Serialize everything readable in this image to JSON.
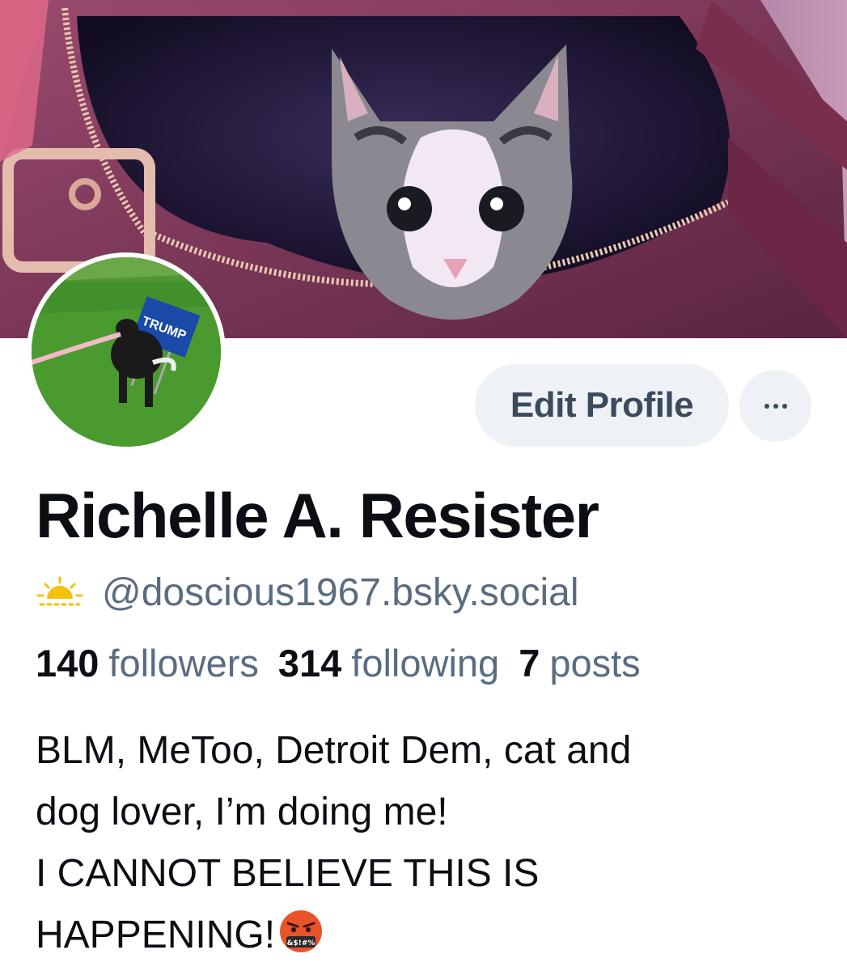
{
  "profile": {
    "display_name": "Richelle A. Resister",
    "handle": "@doscious1967.bsky.social",
    "handle_icon": "sun-icon",
    "edit_button_label": "Edit Profile",
    "more_button_icon": "ellipsis-icon",
    "stats": [
      {
        "count": "140",
        "label": "followers"
      },
      {
        "count": "314",
        "label": "following"
      },
      {
        "count": "7",
        "label": "posts"
      }
    ],
    "bio_lines": [
      "BLM, MeToo, Detroit Dem, cat and",
      "dog lover, I’m doing me!",
      "I CANNOT BELIEVE THIS IS",
      "HAPPENING!"
    ],
    "bio_trailing_icon": "angry-face-cursing-icon",
    "banner_image": "kitten-in-purse-banner",
    "avatar_image": "dog-with-sign-avatar",
    "avatar_sign_text": "TRUMP"
  },
  "colors": {
    "secondary_text": "#5b6c80",
    "button_bg": "#eef2f6",
    "button_text": "#3b4a5c",
    "primary_text": "#0b0f14"
  }
}
